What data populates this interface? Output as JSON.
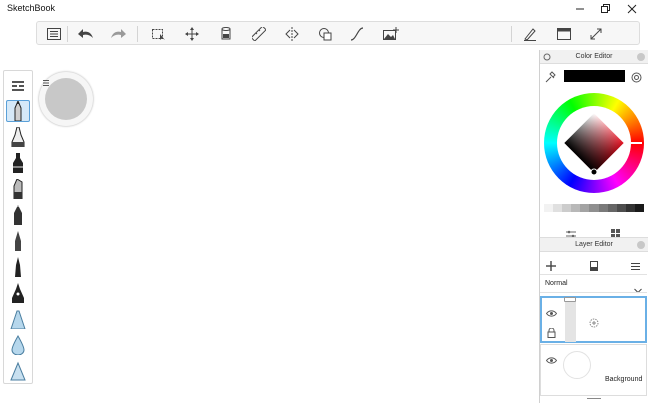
{
  "app": {
    "title": "SketchBook"
  },
  "toolbar": {
    "items": [
      "menu-icon",
      "undo-icon",
      "redo-icon",
      "select-icon",
      "move-icon",
      "fill-icon",
      "ruler-icon",
      "symmetry-icon",
      "shape-icon",
      "curve-icon",
      "add-image-icon",
      "pen-settings-icon",
      "window-icon",
      "fullscreen-icon"
    ]
  },
  "brushes": {
    "items": [
      "brush-library-icon",
      "pencil-brush",
      "inking-pen-brush",
      "marker-brush",
      "chisel-marker-brush",
      "ballpoint-brush",
      "fine-ink-brush",
      "thin-brush",
      "fountain-pen-brush",
      "airbrush-brush",
      "drop-brush",
      "triangle-brush"
    ],
    "active_index": 1
  },
  "color_editor": {
    "title": "Color Editor",
    "current_color": "#000000",
    "greys": [
      "#f2f2f2",
      "#e0e0e0",
      "#cccccc",
      "#b8b8b8",
      "#a3a3a3",
      "#8f8f8f",
      "#7a7a7a",
      "#666666",
      "#4d4d4d",
      "#333333",
      "#1a1a1a"
    ]
  },
  "layer_editor": {
    "title": "Layer Editor",
    "blend_mode": "Normal",
    "layers": [
      {
        "name": "",
        "selected": true
      },
      {
        "name": "Background",
        "selected": false
      }
    ]
  }
}
